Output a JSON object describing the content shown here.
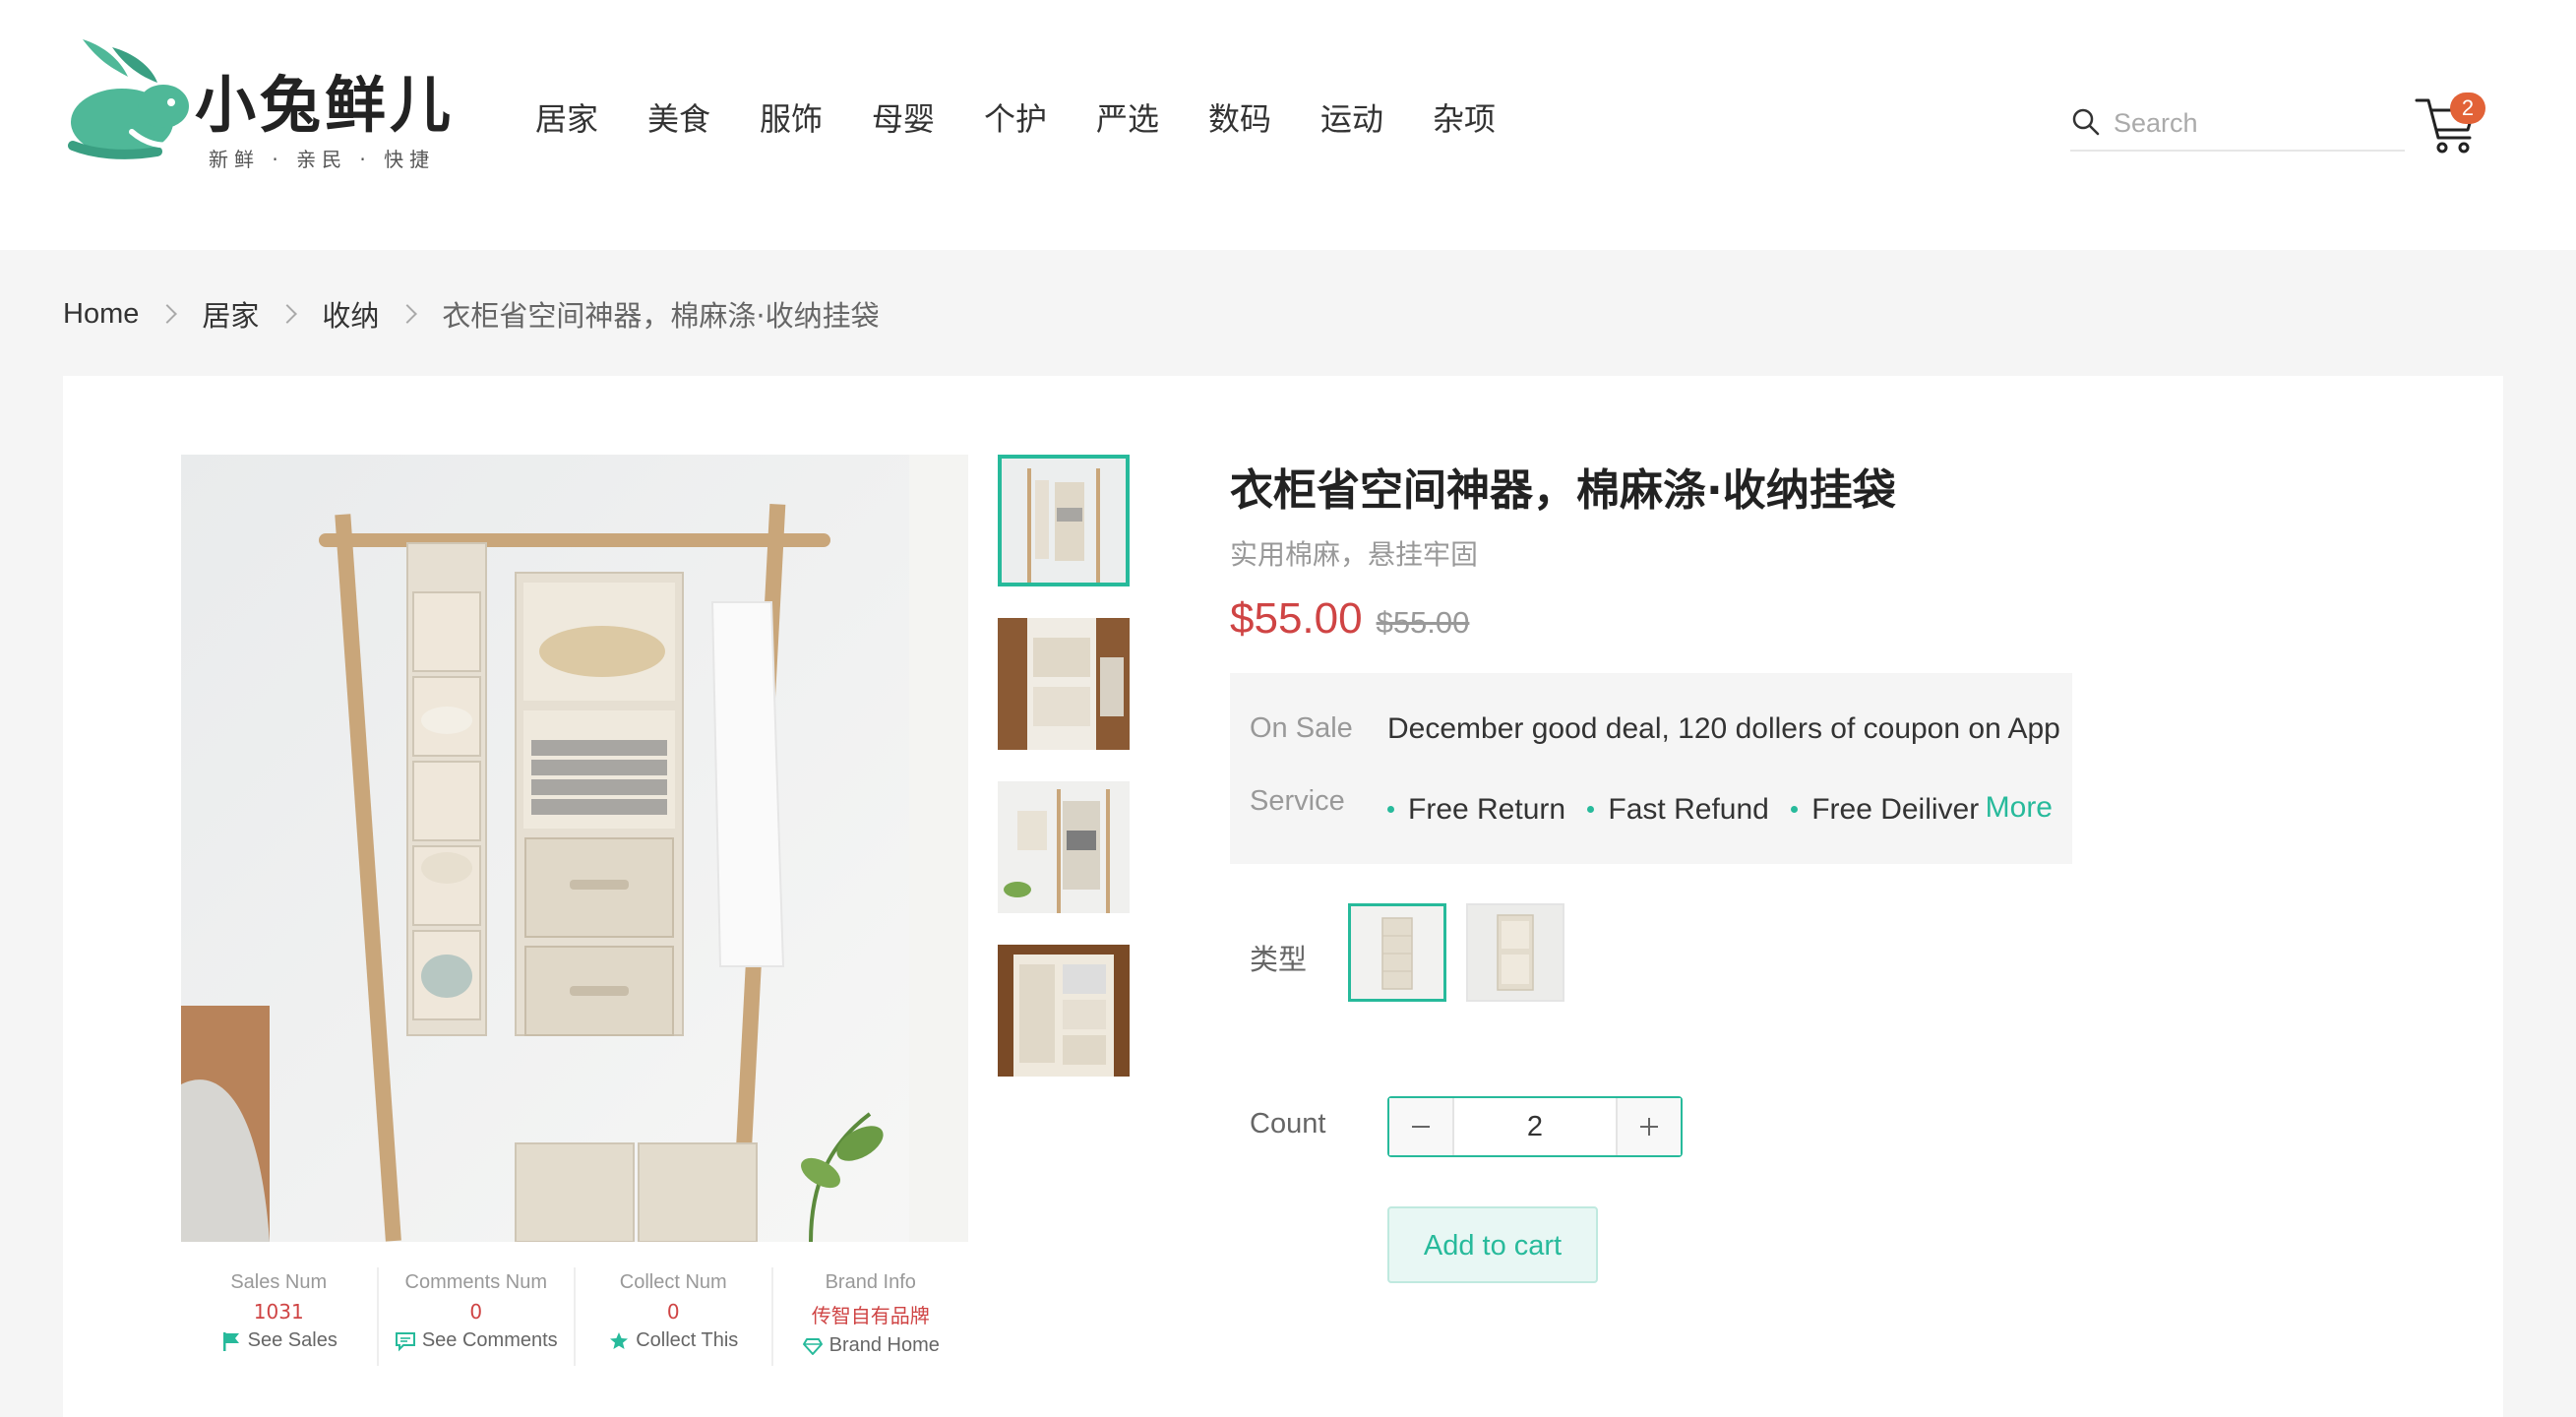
{
  "header": {
    "logo_text": "小兔鲜儿",
    "logo_slogan": "新鲜 · 亲民 · 快捷",
    "nav": [
      "居家",
      "美食",
      "服饰",
      "母婴",
      "个护",
      "严选",
      "数码",
      "运动",
      "杂项"
    ],
    "search_placeholder": "Search",
    "cart_count": "2"
  },
  "breadcrumb": {
    "items": [
      "Home",
      "居家",
      "收纳",
      "衣柜省空间神器，棉麻涤·收纳挂袋"
    ]
  },
  "product": {
    "title": "衣柜省空间神器，棉麻涤·收纳挂袋",
    "subtitle": "实用棉麻，悬挂牢固",
    "price": "$55.00",
    "old_price": "$55.00",
    "promo_label": "On Sale",
    "promo_text": "December good deal, 120 dollers of coupon on App",
    "service_label": "Service",
    "services": [
      "Free Return",
      "Fast Refund",
      "Free Deiliver"
    ],
    "more_label": "More",
    "spec_label": "类型",
    "count_label": "Count",
    "count_value": "2",
    "add_to_cart": "Add to cart"
  },
  "stats": [
    {
      "title": "Sales Num",
      "value": "1031",
      "link": "See Sales",
      "icon": "flag-icon"
    },
    {
      "title": "Comments Num",
      "value": "0",
      "link": "See Comments",
      "icon": "comment-icon"
    },
    {
      "title": "Collect Num",
      "value": "0",
      "link": "Collect This",
      "icon": "star-icon"
    },
    {
      "title": "Brand Info",
      "value": "传智自有品牌",
      "link": "Brand Home",
      "icon": "diamond-icon"
    }
  ],
  "colors": {
    "accent": "#27ba9b",
    "price": "#cf4444",
    "badge": "#e26237"
  }
}
